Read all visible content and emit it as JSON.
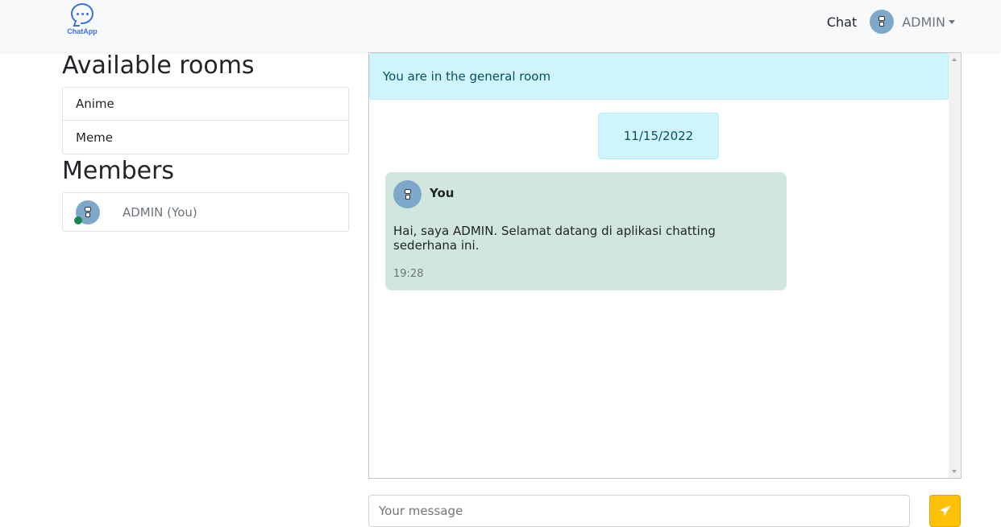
{
  "brand": {
    "logo_text": "ChatApp"
  },
  "nav": {
    "chat_label": "Chat",
    "username": "ADMIN"
  },
  "rooms": {
    "title": "Available rooms",
    "items": [
      "Anime",
      "Meme"
    ]
  },
  "members": {
    "title": "Members",
    "items": [
      {
        "name": "ADMIN (You)",
        "status": "online"
      }
    ]
  },
  "chat": {
    "banner": "You are in the general room",
    "date": "11/15/2022",
    "messages": [
      {
        "sender": "You",
        "text": "Hai, saya ADMIN. Selamat datang di aplikasi chatting sederhana ini.",
        "time": "19:28"
      }
    ]
  },
  "composer": {
    "placeholder": "Your message"
  },
  "colors": {
    "accent": "#ffc107",
    "info": "#cff4fc",
    "message_bg": "#d1e7dd",
    "online": "#198754"
  }
}
